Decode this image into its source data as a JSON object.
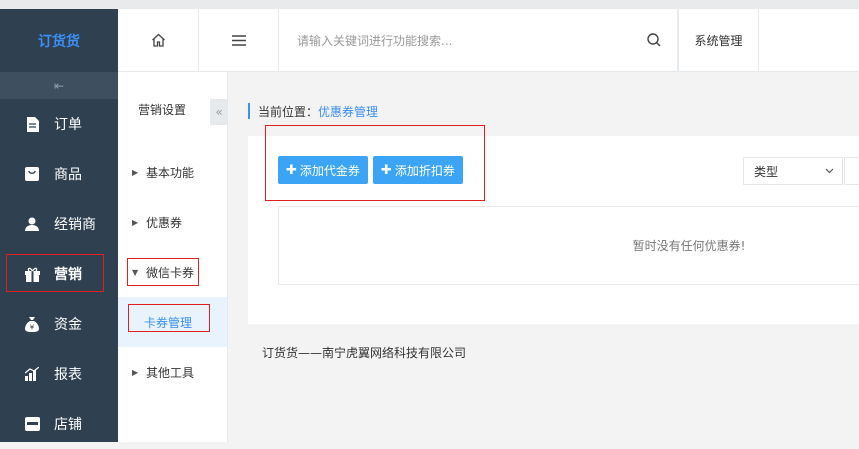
{
  "brand": "订货货",
  "nav": [
    {
      "label": "订单",
      "icon": "file-icon"
    },
    {
      "label": "商品",
      "icon": "box-icon"
    },
    {
      "label": "经销商",
      "icon": "user-icon"
    },
    {
      "label": "营销",
      "icon": "gift-icon",
      "active": true
    },
    {
      "label": "资金",
      "icon": "moneybag-icon"
    },
    {
      "label": "报表",
      "icon": "chart-icon"
    },
    {
      "label": "店铺",
      "icon": "store-icon"
    }
  ],
  "topbar": {
    "search_placeholder": "请输入关键词进行功能搜索...",
    "system": "系统管理"
  },
  "subnav": {
    "title": "营销设置",
    "collapse": "«",
    "items": [
      {
        "label": "基本功能"
      },
      {
        "label": "优惠券"
      },
      {
        "label": "微信卡券"
      },
      {
        "label": "卡券管理"
      },
      {
        "label": "其他工具"
      }
    ]
  },
  "breadcrumb": {
    "prefix": "当前位置：",
    "current": "优惠券管理"
  },
  "buttons": {
    "add_cash": "添加代金券",
    "add_discount": "添加折扣券"
  },
  "filter": {
    "type_label": "类型"
  },
  "empty_text": "暂时没有任何优惠券!",
  "footer": "订货货——南宁虎翼网络科技有限公司"
}
